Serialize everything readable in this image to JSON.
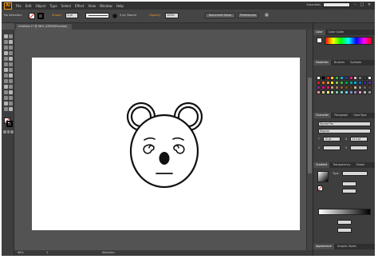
{
  "menubar": {
    "logo": "Ai",
    "items": [
      "File",
      "Edit",
      "Object",
      "Type",
      "Select",
      "Effect",
      "View",
      "Window",
      "Help"
    ],
    "workspace": "Essentials"
  },
  "controlbar": {
    "selection_label": "No Selection",
    "stroke_label": "Stroke:",
    "stroke_weight": "1 pt",
    "brush_label": "5 pt. Round",
    "opacity_label": "Opacity:",
    "opacity_value": "100%",
    "document_setup_label": "Document Setup",
    "preferences_label": "Preferences"
  },
  "document": {
    "tab_title": "Untitled-1* @ 98% (CMYK/Preview)"
  },
  "statusbar": {
    "zoom": "98%",
    "page": "1",
    "tool": "Selection"
  },
  "panels": {
    "color_tabs": [
      "Color",
      "Color Guide"
    ],
    "swatch_tabs": [
      "Swatches",
      "Brushes",
      "Symbols"
    ],
    "character_tabs": [
      "Character",
      "Paragraph",
      "OpenType"
    ],
    "font_family": "Myriad Pro",
    "font_style": "Regular",
    "font_size": "12 pt",
    "leading": "14.4 pt",
    "stroke_tabs": [
      "Gradient",
      "Transparency",
      "Stroke"
    ],
    "gradient_type_label": "Type:",
    "appearance_tabs": [
      "Appearance",
      "Graphic Styles"
    ]
  },
  "colors": {
    "accent": "#f29a1e",
    "chrome_dark": "#323232",
    "chrome_mid": "#535353",
    "artboard": "#ffffff"
  }
}
